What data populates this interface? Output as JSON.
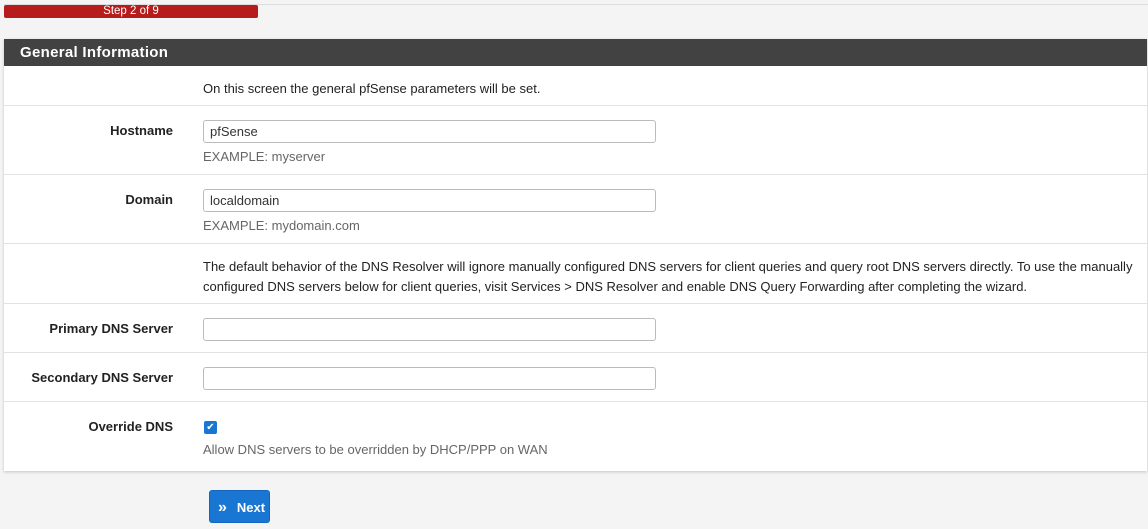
{
  "progress": {
    "label": "Step 2 of 9",
    "percent": 22.2
  },
  "panel": {
    "title": "General Information"
  },
  "intro": "On this screen the general pfSense parameters will be set.",
  "hostname": {
    "label": "Hostname",
    "value": "pfSense",
    "help": "EXAMPLE: myserver"
  },
  "domain": {
    "label": "Domain",
    "value": "localdomain",
    "help": "EXAMPLE: mydomain.com"
  },
  "dns_note": "The default behavior of the DNS Resolver will ignore manually configured DNS servers for client queries and query root DNS servers directly. To use the manually configured DNS servers below for client queries, visit Services > DNS Resolver and enable DNS Query Forwarding after completing the wizard.",
  "primary_dns": {
    "label": "Primary DNS Server",
    "value": ""
  },
  "secondary_dns": {
    "label": "Secondary DNS Server",
    "value": ""
  },
  "override_dns": {
    "label": "Override DNS",
    "checked": true,
    "help": "Allow DNS servers to be overridden by DHCP/PPP on WAN"
  },
  "next_button": {
    "icon": "»",
    "label": "Next"
  }
}
